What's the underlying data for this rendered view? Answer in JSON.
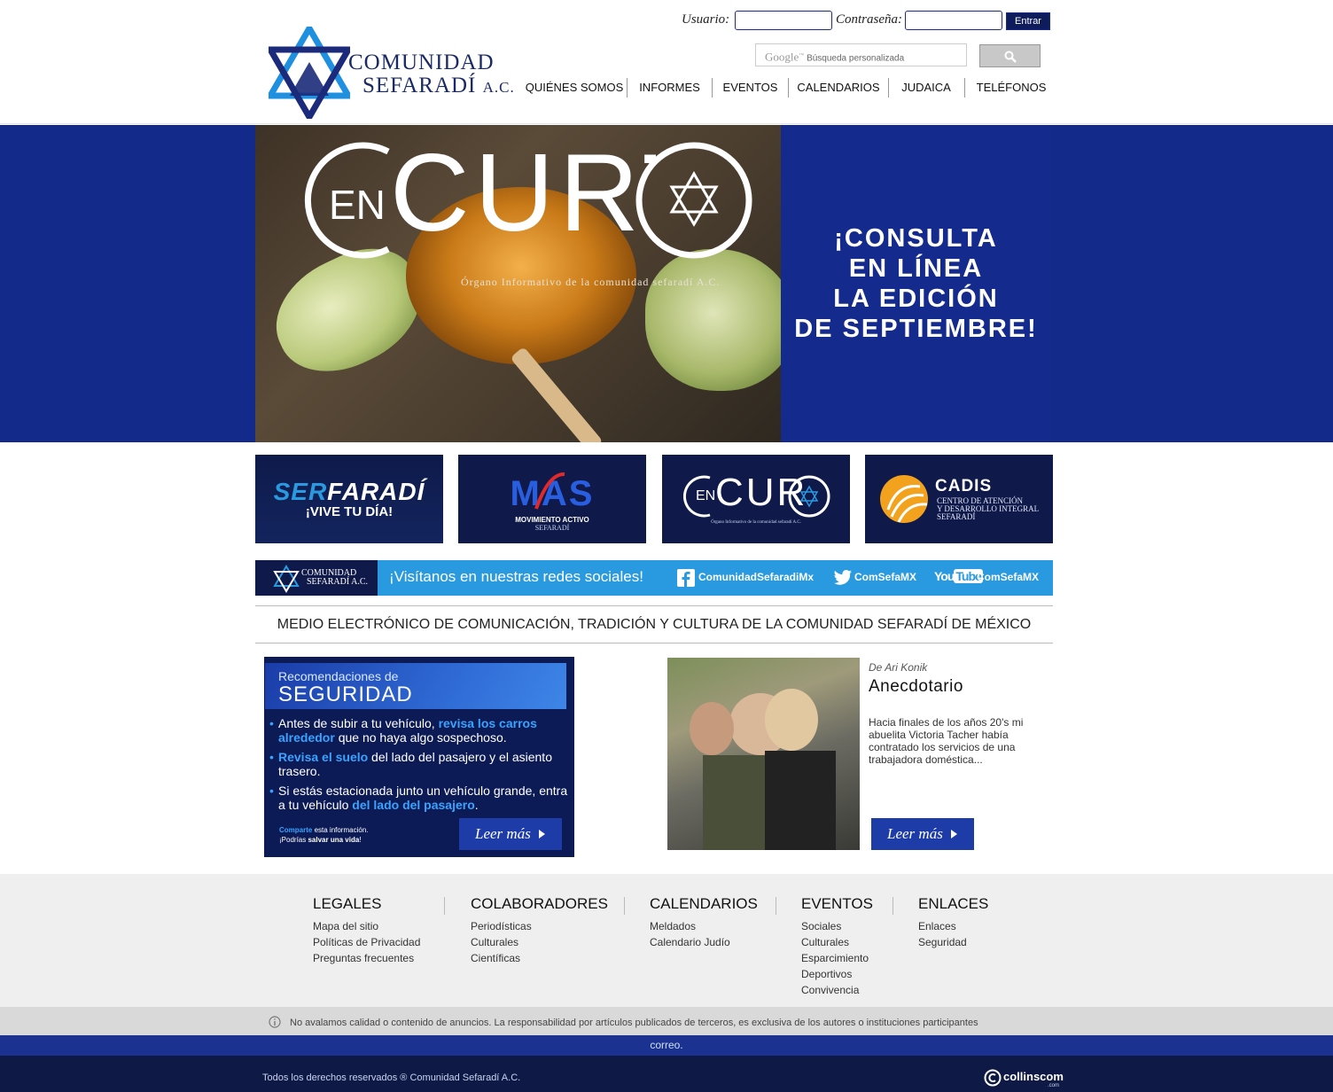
{
  "header": {
    "logo_line1": "COMUNIDAD",
    "logo_line2": "SEFARADÍ",
    "logo_suffix": "A.C.",
    "login": {
      "user_label": "Usuario:",
      "password_label": "Contraseña:",
      "submit_label": "Entrar"
    },
    "search": {
      "brand": "Google",
      "placeholder": "Búsqueda personalizada"
    },
    "nav": [
      "QUIÉNES SOMOS",
      "INFORMES",
      "EVENTOS",
      "CALENDARIOS",
      "JUDAICA",
      "TELÉFONOS"
    ]
  },
  "banner": {
    "logo_en": "EN",
    "logo_curto": "CURTO",
    "subtitle": "Órgano Informativo de la comunidad sefaradí A.C.",
    "cta_lines": [
      "¡CONSULTA",
      "EN LÍNEA",
      "LA EDICIÓN",
      "DE SEPTIEMBRE!"
    ]
  },
  "tiles": {
    "serfaradi": {
      "word_a": "SER",
      "word_b": "FARADÍ",
      "tagline": "¡VIVE TU DÍA!"
    },
    "mas": {
      "title": "MAS",
      "line1": "MOVIMIENTO ACTIVO",
      "line2": "SEFARADÍ"
    },
    "encurto": {
      "en": "EN",
      "curto": "CURTO",
      "subtitle": "Órgano Informativo de la comunidad sefaradí A.C."
    },
    "cadis": {
      "title": "CADIS",
      "line1": "CENTRO DE ATENCIÓN",
      "line2": "Y DESARROLLO INTEGRAL",
      "line3": "SEFARADÍ"
    }
  },
  "social": {
    "logo_line1": "COMUNIDAD",
    "logo_line2": "SEFARADÍ A.C.",
    "invite": "¡Visítanos en nuestras redes sociales!",
    "facebook": "ComunidadSefaradiMx",
    "twitter": "ComSefaMX",
    "youtube_you": "You",
    "youtube_tube": "Tube",
    "youtube": "ComSefaMX"
  },
  "tagline": "MEDIO ELECTRÓNICO DE COMUNICACIÓN, TRADICIÓN Y CULTURA DE LA COMUNIDAD SEFARADÍ DE MÉXICO",
  "seguridad": {
    "kicker": "Recomendaciones de",
    "title": "SEGURIDAD",
    "b1_pre": "Antes de subir a tu vehículo, ",
    "b1_hl": "revisa los carros alrededor",
    "b1_post": " que no haya algo sospechoso.",
    "b2_hl": "Revisa el suelo",
    "b2_post": " del lado del pasajero y el asiento trasero.",
    "b3_pre": "Si estás estacionada junto un vehículo grande, entra a tu vehículo ",
    "b3_hl": "del lado del pasajero",
    "b3_post": ".",
    "share_hl": "Comparte",
    "share_rest": " esta información.",
    "share_line2_pre": "¡Podrías ",
    "share_line2_bold": "salvar una vida",
    "share_line2_post": "!",
    "button": "Leer más"
  },
  "article": {
    "byline": "De Ari Konik",
    "title": "Anecdotario",
    "excerpt": "Hacia finales de los años 20's mi abuelita Victoria Tacher había contratado los servicios de una trabajadora doméstica...",
    "button": "Leer más"
  },
  "footer": {
    "columns": [
      {
        "title": "LEGALES",
        "links": [
          "Mapa del sitio",
          "Políticas de Privacidad",
          "Preguntas frecuentes"
        ]
      },
      {
        "title": "COLABORADORES",
        "links": [
          "Periodísticas",
          "Culturales",
          "Científicas"
        ]
      },
      {
        "title": "CALENDARIOS",
        "links": [
          "Meldados",
          "Calendario Judío"
        ]
      },
      {
        "title": "EVENTOS",
        "links": [
          "Sociales",
          "Culturales",
          "Esparcimiento",
          "Deportivos",
          "Convivencia"
        ]
      },
      {
        "title": "ENLACES",
        "links": [
          "Enlaces",
          "Seguridad"
        ]
      }
    ],
    "disclaimer": "No avalamos calidad o contenido de anuncios. La responsabilidad por artículos publicados de terceros, es exclusiva de los autores o instituciones participantes",
    "correo": "correo.",
    "copyright": "Todos los derechos reservados ® Comunidad Sefaradí A.C.",
    "credit": "collinscom",
    "credit_sub": ".com"
  },
  "colors": {
    "brand_blue": "#132a8a",
    "social_blue": "#2a9ae0",
    "dark_navy": "#0f1a4a",
    "highlight": "#39a3ff"
  }
}
